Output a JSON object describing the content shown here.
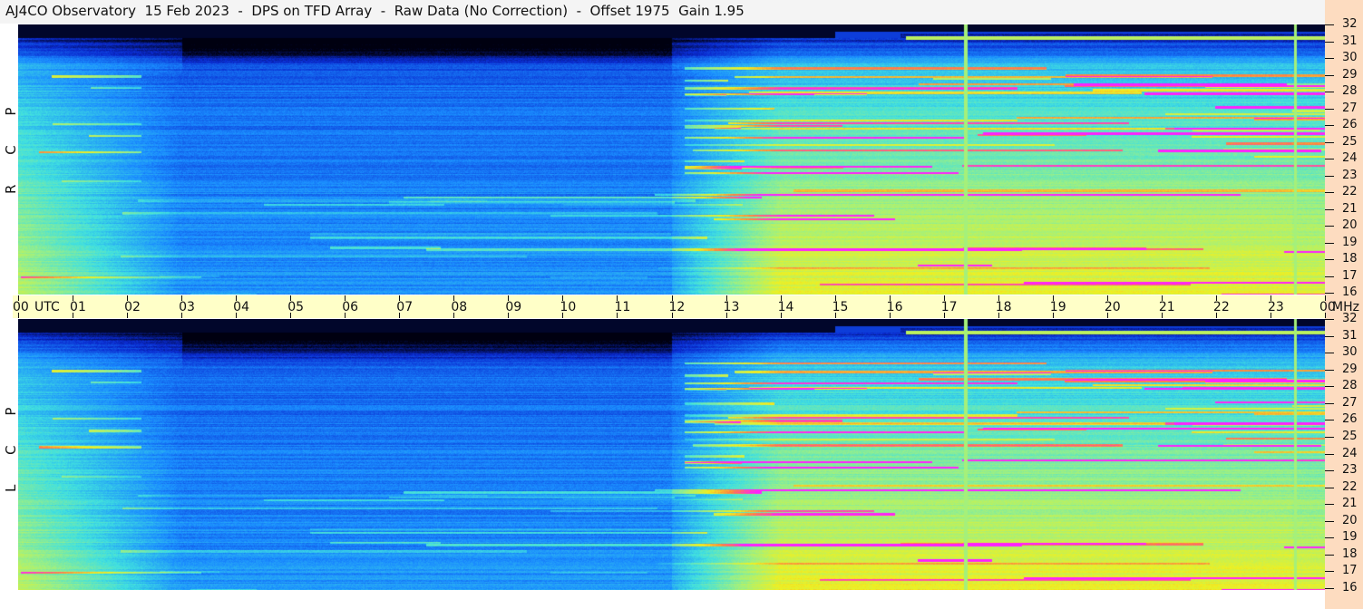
{
  "title": "AJ4CO Observatory  15 Feb 2023  -  DPS on TFD Array  -  Raw Data (No Correction)  -  Offset 1975  Gain 1.95",
  "chart_data": {
    "type": "heatmap",
    "title": "AJ4CO Observatory  15 Feb 2023  -  DPS on TFD Array  -  Raw Data (No Correction)  -  Offset 1975  Gain 1.95",
    "xlabel": "UTC",
    "ylabel": "MHz",
    "x_ticks": [
      "00",
      "01",
      "02",
      "03",
      "04",
      "05",
      "06",
      "07",
      "08",
      "09",
      "10",
      "11",
      "12",
      "13",
      "14",
      "15",
      "16",
      "17",
      "18",
      "19",
      "20",
      "21",
      "22",
      "23",
      "00"
    ],
    "xlim_hours": [
      0,
      24
    ],
    "y_ticks": [
      "32",
      "31",
      "30",
      "29",
      "28",
      "27",
      "26",
      "25",
      "24",
      "23",
      "22",
      "21",
      "20",
      "19",
      "18",
      "17",
      "16"
    ],
    "ylim_mhz": [
      16,
      32
    ],
    "panels": [
      {
        "name": "R C P",
        "polarization": "RCP"
      },
      {
        "name": "L C P",
        "polarization": "LCP"
      }
    ],
    "markers_utc_hours": [
      17.4,
      23.45
    ],
    "colormap": [
      "#000010",
      "#0a2ad0",
      "#1a8cff",
      "#40e0e0",
      "#a0f080",
      "#f0f020",
      "#ff8040",
      "#ff20ff"
    ]
  }
}
